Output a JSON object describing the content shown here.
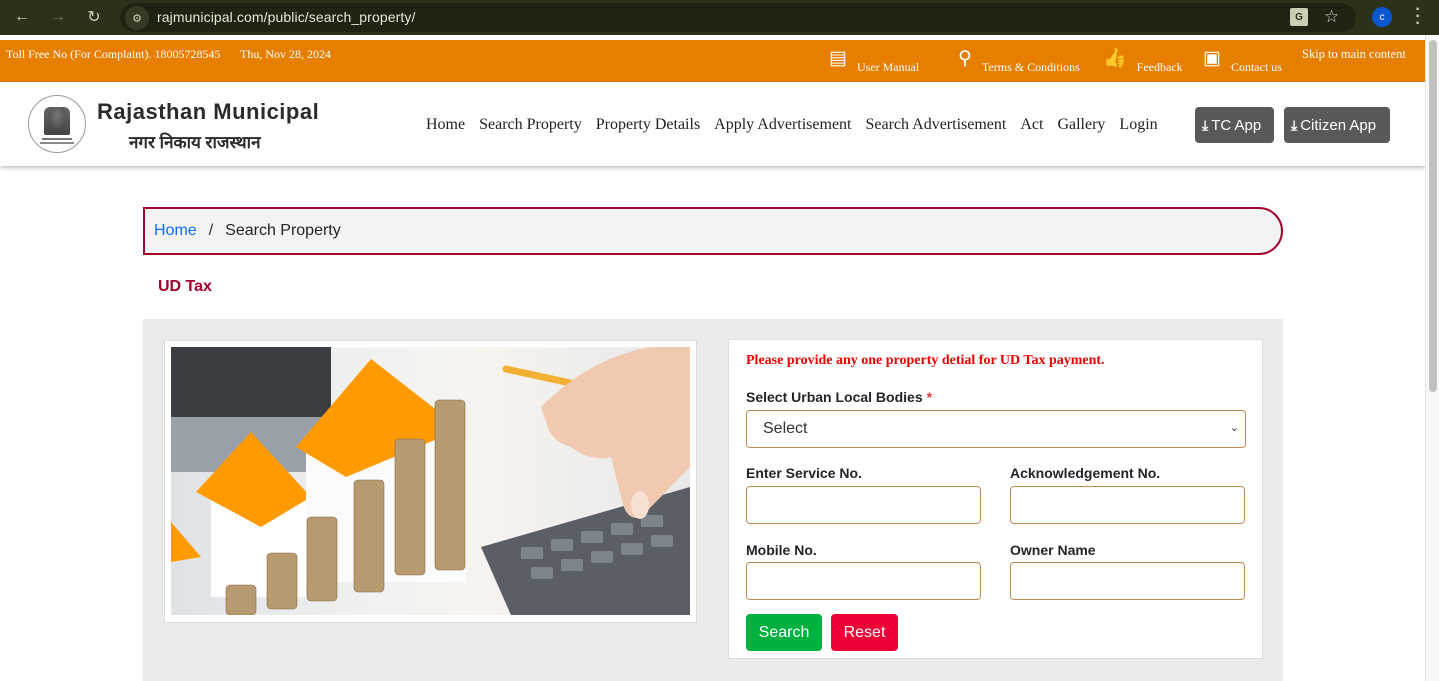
{
  "browser": {
    "url": "rajmunicipal.com/public/search_property/",
    "profile_initial": "c"
  },
  "topbar": {
    "tollfree": "Toll Free No (For Complaint). 18005728545",
    "date": "Thu, Nov 28, 2024",
    "links": [
      {
        "label": "User Manual",
        "icon": "user-manual-icon"
      },
      {
        "label": "Terms & Conditions",
        "icon": "location-pin-icon"
      },
      {
        "label": "Feedback",
        "icon": "thumbs-up-icon"
      },
      {
        "label": "Contact us",
        "icon": "contact-card-icon"
      }
    ],
    "skip": "Skip to main content"
  },
  "header": {
    "title": "Rajasthan Municipal",
    "subtitle": "नगर निकाय राजस्थान",
    "nav": [
      "Home",
      "Search Property",
      "Property Details",
      "Apply Advertisement",
      "Search Advertisement",
      "Act",
      "Gallery",
      "Login"
    ],
    "tc_app": "TC App",
    "citizen_app": "Citizen App"
  },
  "breadcrumb": {
    "home": "Home",
    "separator": "/",
    "current": "Search Property"
  },
  "section_title": "UD Tax",
  "form": {
    "notice": "Please provide any one property detial for UD Tax payment.",
    "ulb_label": "Select Urban Local Bodies",
    "required_mark": "*",
    "ulb_selected": "Select",
    "service_label": "Enter Service No.",
    "service_value": "",
    "ack_label": "Acknowledgement No.",
    "ack_value": "",
    "mobile_label": "Mobile No.",
    "mobile_value": "",
    "owner_label": "Owner Name",
    "owner_value": "",
    "search_button": "Search",
    "reset_button": "Reset"
  },
  "colors": {
    "topbar": "#e67e00",
    "brand_accent": "#a3002b",
    "search_green": "#00b140",
    "reset_red": "#ee0037",
    "notice_red": "#ea0000"
  }
}
